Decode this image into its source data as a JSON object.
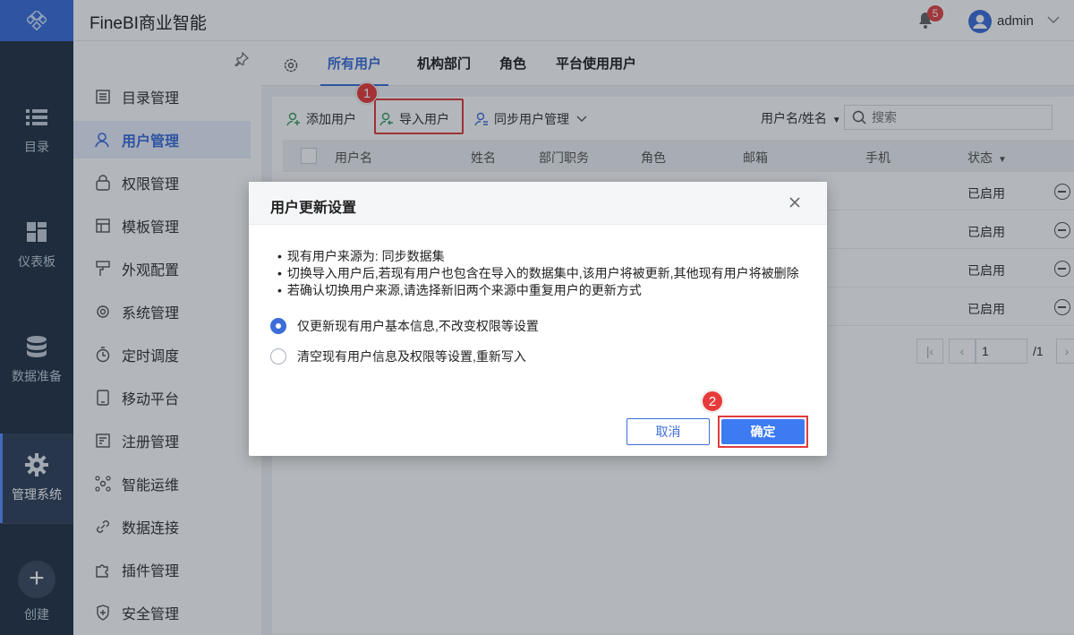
{
  "app": {
    "title": "FineBI商业智能"
  },
  "header": {
    "notification_count": "5",
    "user_name": "admin"
  },
  "rail": {
    "items": [
      {
        "label": "目录",
        "icon": "list-icon"
      },
      {
        "label": "仪表板",
        "icon": "dashboard-icon"
      },
      {
        "label": "数据准备",
        "icon": "database-icon"
      },
      {
        "label": "管理系统",
        "icon": "gear-icon",
        "active": true
      }
    ],
    "create_label": "创建"
  },
  "sidebar": {
    "items": [
      {
        "label": "目录管理",
        "icon": "catalog-icon"
      },
      {
        "label": "用户管理",
        "icon": "user-icon",
        "active": true
      },
      {
        "label": "权限管理",
        "icon": "lock-icon"
      },
      {
        "label": "模板管理",
        "icon": "template-icon"
      },
      {
        "label": "外观配置",
        "icon": "paint-icon"
      },
      {
        "label": "系统管理",
        "icon": "settings-icon"
      },
      {
        "label": "定时调度",
        "icon": "timer-icon"
      },
      {
        "label": "移动平台",
        "icon": "mobile-icon"
      },
      {
        "label": "注册管理",
        "icon": "register-icon"
      },
      {
        "label": "智能运维",
        "icon": "ops-icon"
      },
      {
        "label": "数据连接",
        "icon": "link-icon"
      },
      {
        "label": "插件管理",
        "icon": "plugin-icon"
      },
      {
        "label": "安全管理",
        "icon": "shield-icon"
      }
    ]
  },
  "tabs": [
    {
      "label": "所有用户",
      "active": true
    },
    {
      "label": "机构部门"
    },
    {
      "label": "角色"
    },
    {
      "label": "平台使用用户"
    }
  ],
  "toolbar": {
    "add_user": "添加用户",
    "import_user": "导入用户",
    "sync_user": "同步用户管理",
    "filter_field": "用户名/姓名",
    "search_placeholder": "搜索"
  },
  "steps": {
    "one": "1",
    "two": "2"
  },
  "table": {
    "columns": [
      "用户名",
      "姓名",
      "部门职务",
      "角色",
      "邮箱",
      "手机",
      "状态"
    ],
    "rows": [
      {
        "status": "已启用"
      },
      {
        "status": "已启用"
      },
      {
        "status": "已启用"
      },
      {
        "status": "已启用"
      }
    ]
  },
  "pager": {
    "current_page": "1",
    "total": "/1"
  },
  "dialog": {
    "title": "用户更新设置",
    "notes": [
      "现有用户来源为: 同步数据集",
      "切换导入用户后,若现有用户也包含在导入的数据集中,该用户将被更新,其他现有用户将被删除",
      "若确认切换用户来源,请选择新旧两个来源中重复用户的更新方式"
    ],
    "options": [
      {
        "label": "仅更新现有用户基本信息,不改变权限等设置",
        "selected": true
      },
      {
        "label": "清空现有用户信息及权限等设置,重新写入",
        "selected": false
      }
    ],
    "cancel_label": "取消",
    "confirm_label": "确定"
  },
  "colors": {
    "accent": "#3d6dd9",
    "rail_bg": "#243346",
    "highlight": "#e03c3c"
  }
}
